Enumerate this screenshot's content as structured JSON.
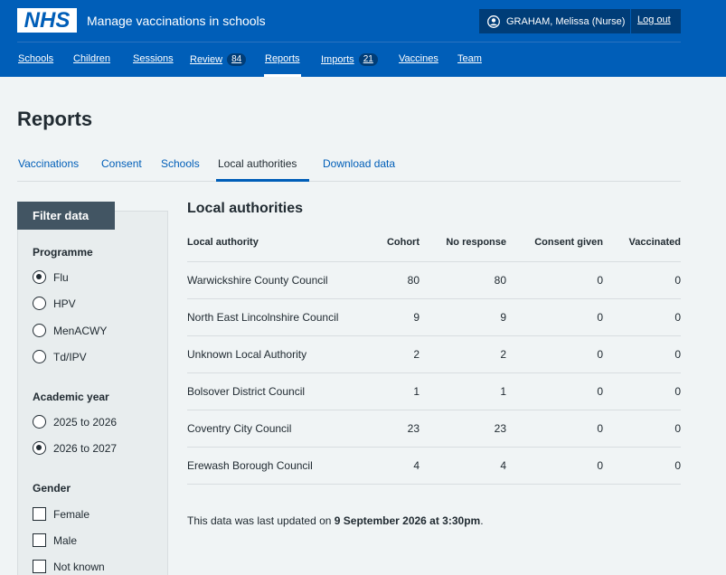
{
  "header": {
    "logo": "NHS",
    "service_name": "Manage vaccinations in schools",
    "user": "GRAHAM, Melissa (Nurse)",
    "logout": "Log out"
  },
  "nav": [
    {
      "label": "Schools"
    },
    {
      "label": "Children"
    },
    {
      "label": "Sessions"
    },
    {
      "label": "Review",
      "badge": "84"
    },
    {
      "label": "Reports"
    },
    {
      "label": "Imports",
      "badge": "21"
    },
    {
      "label": "Vaccines"
    },
    {
      "label": "Team"
    }
  ],
  "page_title": "Reports",
  "subnav": [
    "Vaccinations",
    "Consent",
    "Schools",
    "Local authorities",
    "Download data"
  ],
  "filter": {
    "tab": "Filter data",
    "programme": {
      "heading": "Programme",
      "options": [
        "Flu",
        "HPV",
        "MenACWY",
        "Td/IPV"
      ],
      "selected": "Flu"
    },
    "academic_year": {
      "heading": "Academic year",
      "options": [
        "2025 to 2026",
        "2026 to 2027"
      ],
      "selected": "2026 to 2027"
    },
    "gender": {
      "heading": "Gender",
      "options": [
        "Female",
        "Male",
        "Not known"
      ]
    }
  },
  "content": {
    "title": "Local authorities",
    "columns": [
      "Local authority",
      "Cohort",
      "No response",
      "Consent given",
      "Vaccinated"
    ],
    "rows": [
      [
        "Warwickshire County Council",
        "80",
        "80",
        "0",
        "0"
      ],
      [
        "North East Lincolnshire Council",
        "9",
        "9",
        "0",
        "0"
      ],
      [
        "Unknown Local Authority",
        "2",
        "2",
        "0",
        "0"
      ],
      [
        "Bolsover District Council",
        "1",
        "1",
        "0",
        "0"
      ],
      [
        "Coventry City Council",
        "23",
        "23",
        "0",
        "0"
      ],
      [
        "Erewash Borough Council",
        "4",
        "4",
        "0",
        "0"
      ]
    ],
    "updated_prefix": "This data was last updated on ",
    "updated_date": "9 September 2026 at 3:30pm",
    "updated_suffix": "."
  },
  "colors": {
    "nhs_blue": "#005eb8",
    "dark_blue": "#003d78",
    "filter_tab": "#425563"
  }
}
